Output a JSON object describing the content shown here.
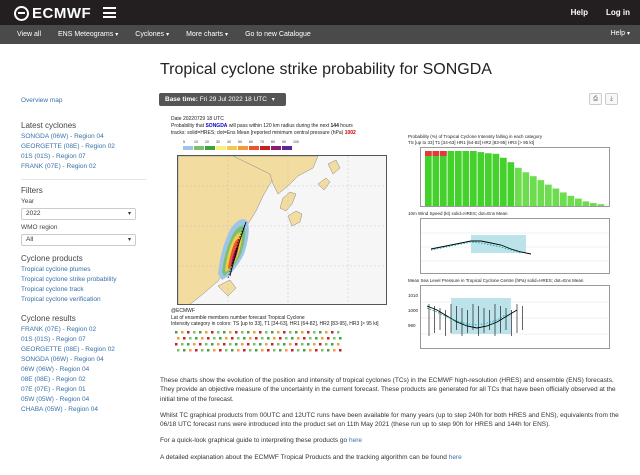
{
  "topbar": {
    "logo_text": "ECMWF",
    "help": "Help",
    "login": "Log in"
  },
  "nav": {
    "items": [
      "View all",
      "ENS Meteograms",
      "Cyclones",
      "More charts",
      "Go to new Catalogue"
    ],
    "help": "Help"
  },
  "page_title": "Tropical cyclone strike probability for SONGDA",
  "sidebar": {
    "overview": "Overview map",
    "latest_heading": "Latest cyclones",
    "latest": [
      "SONGDA (06W) - Region 04",
      "GEORGETTE (08E) - Region 02",
      "01S (01S) - Region 07",
      "FRANK (07E) - Region 02"
    ],
    "filters_heading": "Filters",
    "year_label": "Year",
    "year_value": "2022",
    "wmo_label": "WMO region",
    "wmo_value": "All",
    "products_heading": "Cyclone products",
    "products": [
      "Tropical cyclone plumes",
      "Tropical cyclone strike probability",
      "Tropical cyclone track",
      "Tropical cyclone verification"
    ],
    "results_heading": "Cyclone results",
    "results": [
      "FRANK (07E) - Region 02",
      "01S (01S) - Region 07",
      "GEORGETTE (08E) - Region 02",
      "SONGDA (06W) - Region 04",
      "06W (06W) - Region 04",
      "08E (08E) - Region 02",
      "07E (07E) - Region 01",
      "05W (05W) - Region 04",
      "CHABA (05W) - Region 04"
    ]
  },
  "basetime": {
    "label": "Base time:",
    "value": "Fri 29 Jul 2022 18 UTC"
  },
  "product": {
    "date_line": "Date 20220729 18 UTC",
    "ecmwf_tag": "@ECMWF",
    "prob_line_a": "Probability that",
    "storm_name": "SONGDA",
    "prob_line_b": "will pass within 120 km radius during the next",
    "hours": "144",
    "hours_unit": "hours",
    "tracks_line": "tracks: solid=HRES; dot=Ens Mean [reported minimum central pressure (hPa)",
    "pressure": "1002",
    "legend_labels": [
      "5",
      "10",
      "20",
      "30",
      "40",
      "50",
      "60",
      "70",
      "80",
      "90",
      "100"
    ],
    "legend_colors": [
      "#9ec5e8",
      "#79c070",
      "#3fa33c",
      "#f5f07a",
      "#f2c94c",
      "#f29a3a",
      "#e8562a",
      "#c52121",
      "#8e1c6e",
      "#5e2596"
    ],
    "map_caption_1": "Lat of ensemble members number forecast Tropical Cyclone",
    "map_caption_2": "Intensity category in colors: TS [up to 33], T1 [34-63], HR1 [64-82], HR2 [83-95], HR3 [> 95 kt]",
    "panel1_title": "Probability (%) of Tropical Cyclone Intensity falling in each category",
    "panel1_legend": "TS [up to 33]  T1 [34-63]  HR1 [64-82]  HR2 [83-95]  HR3 [> 95 kt]",
    "panel2_title": "10m Wind Speed (kt) solid=HRES; dot=Ens Mean",
    "panel3_title": "Mean Sea Level Pressure in Tropical Cyclone Centre (hPa) solid=HRES; dot=Ens Mean",
    "panel3_yticks": [
      "1010",
      "1000",
      "990"
    ],
    "bar_values": [
      100,
      100,
      100,
      100,
      100,
      100,
      100,
      98,
      96,
      95,
      88,
      80,
      70,
      62,
      55,
      48,
      40,
      33,
      26,
      20,
      15,
      10,
      7,
      5
    ]
  },
  "description": {
    "p1": "These charts show the evolution of the position and intensity of tropical cyclones (TCs) in the ECMWF high-resolution (HRES) and ensemble (ENS) forecasts. They provide an objective measure of the uncertainty in the current forecast. These products are generated for all TCs that have been officially observed at the initial time of the forecast.",
    "p2": "Whilst TC graphical products from 00UTC and 12UTC runs have been available for many years (up to step 240h for both HRES and ENS), equivalents from the 06/18 UTC forecast runs were introduced into the product set on 11th May 2021 (these run up to step 90h for HRES and 144h for ENS).",
    "p3_text": "For a quick-look graphical guide to interpreting these products go",
    "p3_link": "here",
    "p4_text": "A detailed explanation about the ECMWF Tropical Products and the tracking algorithm can be found",
    "p4_link": "here"
  }
}
